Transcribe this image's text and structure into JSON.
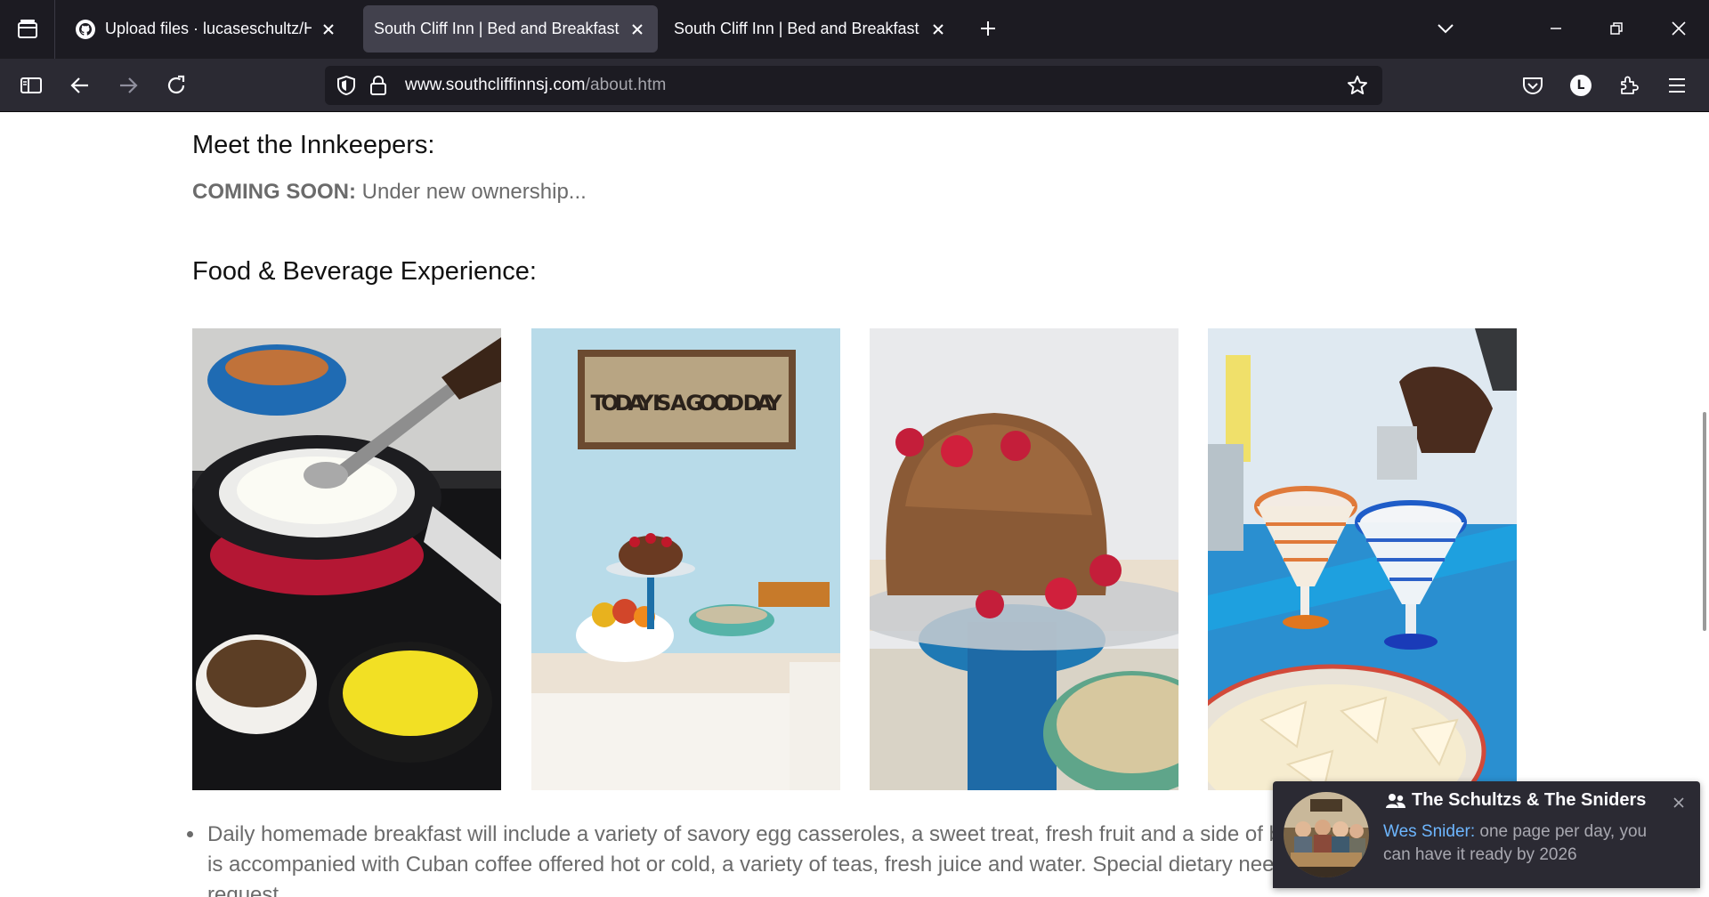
{
  "browser": {
    "tabs": [
      {
        "title": "Upload files · lucaseschultz/HTTP",
        "icon": "github-icon",
        "active": false
      },
      {
        "title": "South Cliff Inn | Bed and Breakfast | Inn",
        "icon": "",
        "active": true
      },
      {
        "title": "South Cliff Inn | Bed and Breakfast | Inn",
        "icon": "",
        "active": false
      }
    ],
    "url": {
      "domain": "www.southcliffinnsj.com",
      "path": "/about.htm"
    },
    "account_initial": "L"
  },
  "page": {
    "innkeepers_heading": "Meet the Innkeepers:",
    "coming_soon_label": "COMING SOON:",
    "coming_soon_text": " Under new ownership...",
    "food_heading": "Food & Beverage Experience:",
    "sign_text": "TODAY IS A GOOD DAY",
    "bullets": [
      "Daily homemade breakfast will include a variety of savory egg casseroles, a sweet treat, fresh fruit and a side of b",
      "is accompanied with Cuban coffee offered hot or cold, a variety of teas, fresh juice and water. Special dietary nee",
      "request."
    ]
  },
  "notification": {
    "group": "The Schultzs & The Sniders",
    "sender": "Wes Snider:",
    "message": " one page per day, you can have it ready by 2026"
  }
}
